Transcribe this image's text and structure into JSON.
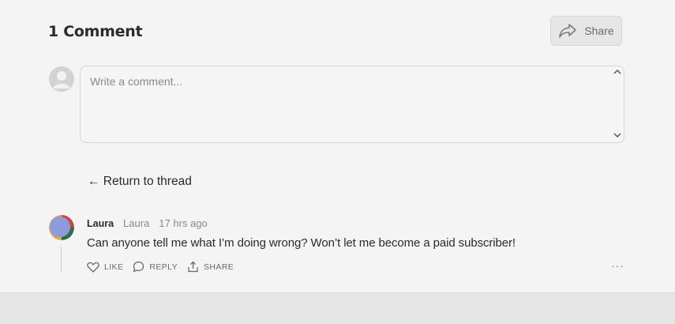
{
  "header": {
    "title": "1 Comment",
    "share_label": "Share"
  },
  "composer": {
    "placeholder": "Write a comment...",
    "avatar_icon": "user-avatar-icon"
  },
  "return_link": {
    "label": "← Return to thread"
  },
  "comment": {
    "author_name": "Laura",
    "author_handle": "Laura",
    "time": "17 hrs ago",
    "body": "Can anyone tell me what I’m doing wrong? Won’t let me become a paid subscriber!",
    "actions": {
      "like": "LIKE",
      "reply": "REPLY",
      "share": "SHARE"
    },
    "more_label": "···"
  },
  "colors": {
    "background": "#f4f4f4",
    "share_button_bg": "#e6e6e6",
    "footer_band": "#e6e6e6",
    "avatar_primary": "#8d9bdc"
  }
}
